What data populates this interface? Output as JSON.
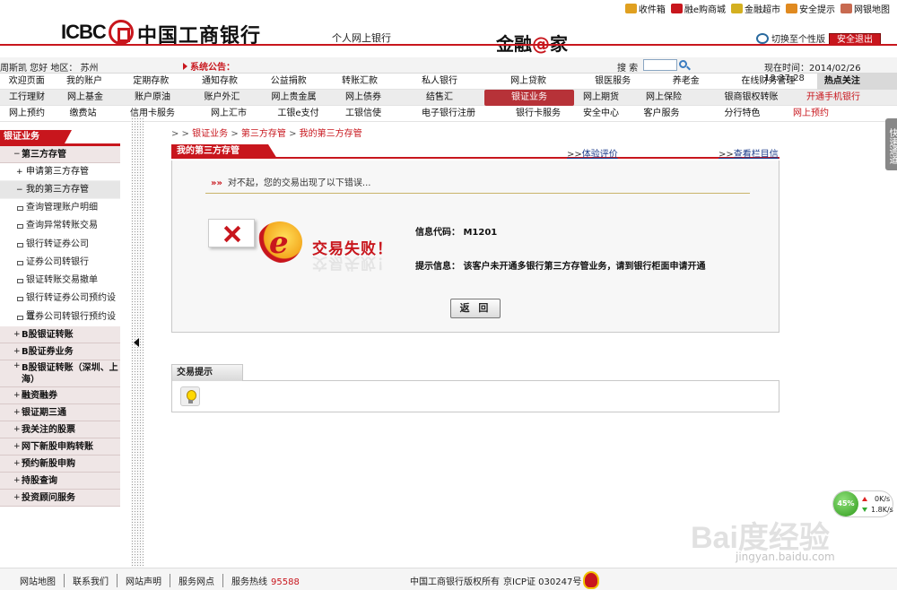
{
  "brand": {
    "logo_text": "ICBC",
    "bank_name": "中国工商银行",
    "slogan": "个人网上银行",
    "jrj_left": "金融",
    "jrj_at": "@",
    "jrj_right": "家",
    "switch_view": "切换至个性版",
    "logout": "安全退出"
  },
  "toplinks": [
    {
      "label": "收件箱",
      "icon": "inbox-icon",
      "color": "#e0a020"
    },
    {
      "label": "融e购商城",
      "icon": "shopping-cart-icon",
      "color": "#c8161d"
    },
    {
      "label": "金融超市",
      "icon": "shopping-bag-icon",
      "color": "#d4b020"
    },
    {
      "label": "安全提示",
      "icon": "lock-icon",
      "color": "#e08a20"
    },
    {
      "label": "网银地图",
      "icon": "map-icon",
      "color": "#c86a50"
    }
  ],
  "infobar": {
    "greeting": "周斯凯 您好 地区： 苏州",
    "notice": "系统公告：",
    "search_label": "搜 索",
    "search_value": "",
    "time": "现在时间：2014/02/26 13:37:28"
  },
  "nav": {
    "row1": [
      "欢迎页面",
      "我的账户",
      "定期存款",
      "通知存款",
      "公益捐款",
      "转账汇款",
      "私人银行",
      "网上贷款",
      "银医服务",
      "养老金",
      "在线财务管理",
      "热点关注"
    ],
    "row2": [
      "工行理财",
      "网上基金",
      "账户原油",
      "账户外汇",
      "网上贵金属",
      "网上债券",
      "结售汇",
      "银证业务",
      "网上期货",
      "网上保险",
      "银商银权转账",
      "开通手机银行"
    ],
    "row3": [
      "网上预约",
      "缴费站",
      "信用卡服务",
      "网上汇市",
      "工银e支付",
      "工银信使",
      "电子银行注册",
      "银行卡服务",
      "安全中心",
      "客户服务",
      "分行特色",
      "网上预约"
    ]
  },
  "sidebar": {
    "title": "银证业务",
    "group1": "第三方存管",
    "sub1": "申请第三方存管",
    "sub2": "我的第三方存管",
    "leaves": [
      "查询管理账户明细",
      "查询异常转账交易",
      "银行转证券公司",
      "证券公司转银行",
      "银证转账交易撤单",
      "银行转证券公司预约设置",
      "证券公司转银行预约设置"
    ],
    "cats": [
      "B股银证转账",
      "B股证券业务",
      "B股银证转账（深圳、上海）",
      "融资融券",
      "银证期三通",
      "我关注的股票",
      "网下新股申购转账",
      "预约新股申购",
      "持股查询",
      "投资顾问服务"
    ]
  },
  "content": {
    "breadcrumb": {
      "prefix": "> >",
      "c1": "银证业务",
      "c2": "第三方存管",
      "c3": "我的第三方存管",
      "sep": ">"
    },
    "panel_title": "我的第三方存管",
    "link_feedback": "体验评价",
    "link_info": "查看栏目信息",
    "link_prefix": ">>",
    "error_arrows": "»»",
    "error_message": "对不起，您的交易出现了以下错误...",
    "fail_title": "交易失败！",
    "info_code": "信息代码：  M1201",
    "info_tip": "提示信息：  该客户未开通多银行第三方存管业务，请到银行柜面申请开通",
    "back_button": "返 回",
    "tips_title": "交易提示"
  },
  "quick_tab": "快速通道",
  "speed": {
    "percent": "45%",
    "up": "0K/s",
    "down": "1.8K/s"
  },
  "watermark": {
    "text": "Bai度经验",
    "url": "jingyan.baidu.com"
  },
  "footer": {
    "links": [
      "网站地图",
      "联系我们",
      "网站声明",
      "服务网点"
    ],
    "hotline_label": "服务热线",
    "hotline": "95588",
    "copyright": "中国工商银行版权所有",
    "icp": "京ICP证 030247号"
  },
  "colors": {
    "brand_red": "#c8161d"
  }
}
